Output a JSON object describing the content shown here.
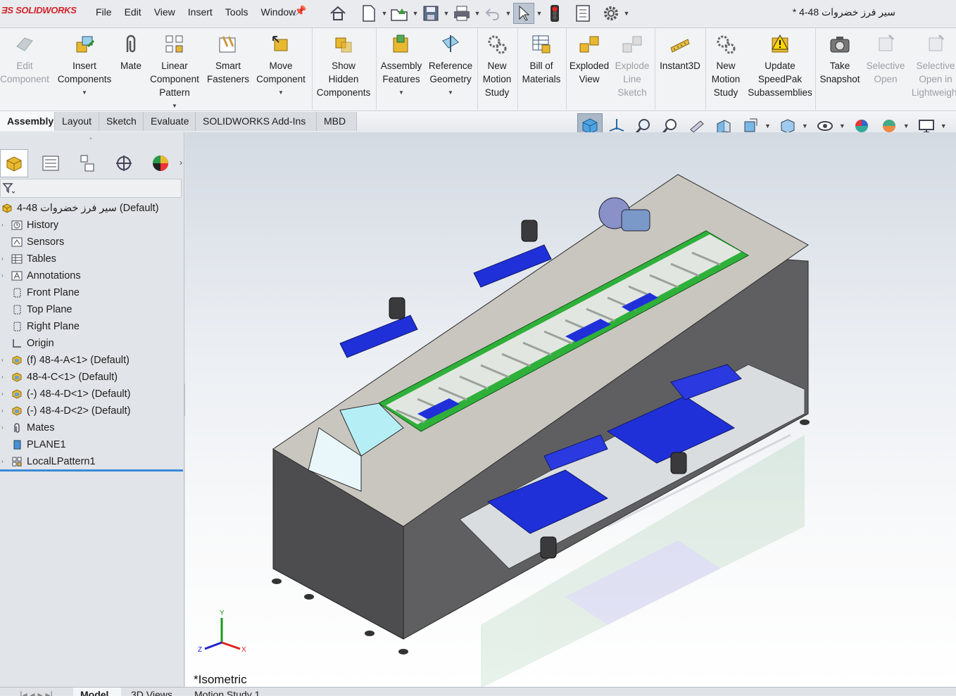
{
  "app": {
    "logo": "SOLIDWORKS",
    "document_title": "* سير فرز خضروات 48-4"
  },
  "menu": [
    "File",
    "Edit",
    "View",
    "Insert",
    "Tools",
    "Window"
  ],
  "ribbon": [
    {
      "label1": "Edit",
      "label2": "Component",
      "label3": "",
      "disabled": true,
      "icon": "edit-component-icon"
    },
    {
      "label1": "Insert",
      "label2": "Components",
      "label3": "",
      "disabled": false,
      "icon": "insert-components-icon"
    },
    {
      "label1": "Mate",
      "label2": "",
      "label3": "",
      "disabled": false,
      "icon": "mate-icon"
    },
    {
      "label1": "Linear",
      "label2": "Component",
      "label3": "Pattern",
      "disabled": false,
      "icon": "linear-pattern-icon"
    },
    {
      "label1": "Smart",
      "label2": "Fasteners",
      "label3": "",
      "disabled": false,
      "icon": "smart-fasteners-icon"
    },
    {
      "label1": "Move",
      "label2": "Component",
      "label3": "",
      "disabled": false,
      "icon": "move-component-icon"
    },
    {
      "label1": "Show",
      "label2": "Hidden",
      "label3": "Components",
      "disabled": false,
      "icon": "show-hidden-icon"
    },
    {
      "label1": "Assembly",
      "label2": "Features",
      "label3": "",
      "disabled": false,
      "icon": "assembly-features-icon"
    },
    {
      "label1": "Reference",
      "label2": "Geometry",
      "label3": "",
      "disabled": false,
      "icon": "reference-geometry-icon"
    },
    {
      "label1": "New",
      "label2": "Motion",
      "label3": "Study",
      "disabled": false,
      "icon": "motion-study-icon"
    },
    {
      "label1": "Bill of",
      "label2": "Materials",
      "label3": "",
      "disabled": false,
      "icon": "bom-icon"
    },
    {
      "label1": "Exploded",
      "label2": "View",
      "label3": "",
      "disabled": false,
      "icon": "exploded-view-icon"
    },
    {
      "label1": "Explode",
      "label2": "Line",
      "label3": "Sketch",
      "disabled": true,
      "icon": "explode-line-icon"
    },
    {
      "label1": "Instant3D",
      "label2": "",
      "label3": "",
      "disabled": false,
      "icon": "instant3d-icon"
    },
    {
      "label1": "New",
      "label2": "Motion",
      "label3": "Study",
      "disabled": false,
      "icon": "motion-study-icon"
    },
    {
      "label1": "Update",
      "label2": "SpeedPak",
      "label3": "Subassemblies",
      "disabled": false,
      "icon": "speedpak-icon"
    },
    {
      "label1": "Take",
      "label2": "Snapshot",
      "label3": "",
      "disabled": false,
      "icon": "camera-icon"
    },
    {
      "label1": "Selective",
      "label2": "Open",
      "label3": "",
      "disabled": true,
      "icon": "selective-open-icon"
    },
    {
      "label1": "Selective",
      "label2": "Open in",
      "label3": "Lightweight",
      "disabled": true,
      "icon": "selective-open-lw-icon"
    }
  ],
  "tabs": [
    "Assembly",
    "Layout",
    "Sketch",
    "Evaluate",
    "SOLIDWORKS Add-Ins",
    "MBD"
  ],
  "tree": [
    {
      "label": "سير فرز خضروات 48-4  (Default)",
      "icon": "assembly-icon",
      "level": 0
    },
    {
      "label": "History",
      "icon": "history-icon",
      "level": 1
    },
    {
      "label": "Sensors",
      "icon": "sensors-icon",
      "level": 1
    },
    {
      "label": "Tables",
      "icon": "tables-icon",
      "level": 1
    },
    {
      "label": "Annotations",
      "icon": "annotations-icon",
      "level": 1
    },
    {
      "label": "Front Plane",
      "icon": "plane-icon",
      "level": 1
    },
    {
      "label": "Top Plane",
      "icon": "plane-icon",
      "level": 1
    },
    {
      "label": "Right Plane",
      "icon": "plane-icon",
      "level": 1
    },
    {
      "label": "Origin",
      "icon": "origin-icon",
      "level": 1
    },
    {
      "label": "(f) 48-4-A<1> (Default)",
      "icon": "subassembly-icon",
      "level": 1
    },
    {
      "label": "48-4-C<1> (Default)",
      "icon": "subassembly-icon",
      "level": 1
    },
    {
      "label": "(-) 48-4-D<1> (Default)",
      "icon": "subassembly-icon",
      "level": 1
    },
    {
      "label": "(-) 48-4-D<2> (Default)",
      "icon": "subassembly-icon",
      "level": 1
    },
    {
      "label": "Mates",
      "icon": "mates-icon",
      "level": 1
    },
    {
      "label": "PLANE1",
      "icon": "plane-icon",
      "level": 1
    },
    {
      "label": "LocalLPattern1",
      "icon": "pattern-icon",
      "level": 1
    }
  ],
  "viewport": {
    "view_label": "*Isometric",
    "axes": {
      "x": "X",
      "y": "Y",
      "z": "Z"
    }
  },
  "bottom_tabs": [
    "Model",
    "3D Views",
    "Motion Study 1"
  ]
}
